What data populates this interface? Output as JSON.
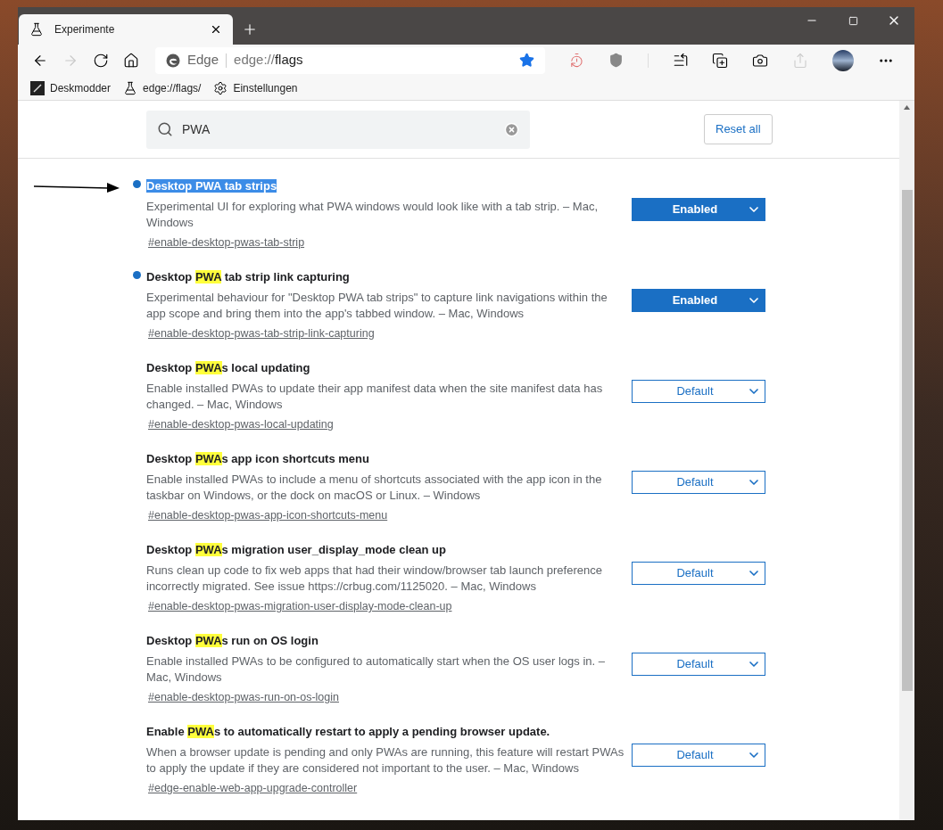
{
  "window": {
    "tab": {
      "title": "Experimente",
      "selected": true
    }
  },
  "address_bar": {
    "site_label": "Edge",
    "url_prefix": "edge://",
    "url_host": "flags",
    "bookmarked": true
  },
  "bookmarks": [
    {
      "label": "Deskmodder",
      "kind": "site"
    },
    {
      "label": "edge://flags/",
      "kind": "flask"
    },
    {
      "label": "Einstellungen",
      "kind": "gear"
    }
  ],
  "search": {
    "value": "PWA"
  },
  "reset_button": "Reset all",
  "flags": [
    {
      "title": [
        {
          "text": "Desktop PWA tab strips"
        }
      ],
      "selected": true,
      "modified": true,
      "description": "Experimental UI for exploring what PWA windows would look like with a tab strip. – Mac, Windows",
      "link": "#enable-desktop-pwas-tab-strip",
      "value": "Enabled"
    },
    {
      "title": [
        {
          "text": "Desktop ",
          "match": false
        },
        {
          "text": "PWA",
          "match": true
        },
        {
          "text": " tab strip link capturing",
          "match": false
        }
      ],
      "selected": false,
      "modified": true,
      "description": "Experimental behaviour for \"Desktop PWA tab strips\" to capture link navigations within the app scope and bring them into the app's tabbed window. – Mac, Windows",
      "link": "#enable-desktop-pwas-tab-strip-link-capturing",
      "value": "Enabled"
    },
    {
      "title": [
        {
          "text": "Desktop ",
          "match": false
        },
        {
          "text": "PWA",
          "match": true
        },
        {
          "text": "s local updating",
          "match": false
        }
      ],
      "selected": false,
      "modified": false,
      "description": "Enable installed PWAs to update their app manifest data when the site manifest data has changed. – Mac, Windows",
      "link": "#enable-desktop-pwas-local-updating",
      "value": "Default"
    },
    {
      "title": [
        {
          "text": "Desktop ",
          "match": false
        },
        {
          "text": "PWA",
          "match": true
        },
        {
          "text": "s app icon shortcuts menu",
          "match": false
        }
      ],
      "selected": false,
      "modified": false,
      "description": "Enable installed PWAs to include a menu of shortcuts associated with the app icon in the taskbar on Windows, or the dock on macOS or Linux. – Windows",
      "link": "#enable-desktop-pwas-app-icon-shortcuts-menu",
      "value": "Default"
    },
    {
      "title": [
        {
          "text": "Desktop ",
          "match": false
        },
        {
          "text": "PWA",
          "match": true
        },
        {
          "text": "s migration user_display_mode clean up",
          "match": false
        }
      ],
      "selected": false,
      "modified": false,
      "description": "Runs clean up code to fix web apps that had their window/browser tab launch preference incorrectly migrated. See issue https://crbug.com/1125020. – Mac, Windows",
      "link": "#enable-desktop-pwas-migration-user-display-mode-clean-up",
      "value": "Default"
    },
    {
      "title": [
        {
          "text": "Desktop ",
          "match": false
        },
        {
          "text": "PWA",
          "match": true
        },
        {
          "text": "s run on OS login",
          "match": false
        }
      ],
      "selected": false,
      "modified": false,
      "description": "Enable installed PWAs to be configured to automatically start when the OS user logs in. – Mac, Windows",
      "link": "#enable-desktop-pwas-run-on-os-login",
      "value": "Default"
    },
    {
      "title": [
        {
          "text": "Enable ",
          "match": false
        },
        {
          "text": "PWA",
          "match": true
        },
        {
          "text": "s to automatically restart to apply a pending browser update.",
          "match": false
        }
      ],
      "selected": false,
      "modified": false,
      "description": "When a browser update is pending and only PWAs are running, this feature will restart PWAs to apply the update if they are considered not important to the user. – Mac, Windows",
      "link": "#edge-enable-web-app-upgrade-controller",
      "value": "Default"
    }
  ]
}
